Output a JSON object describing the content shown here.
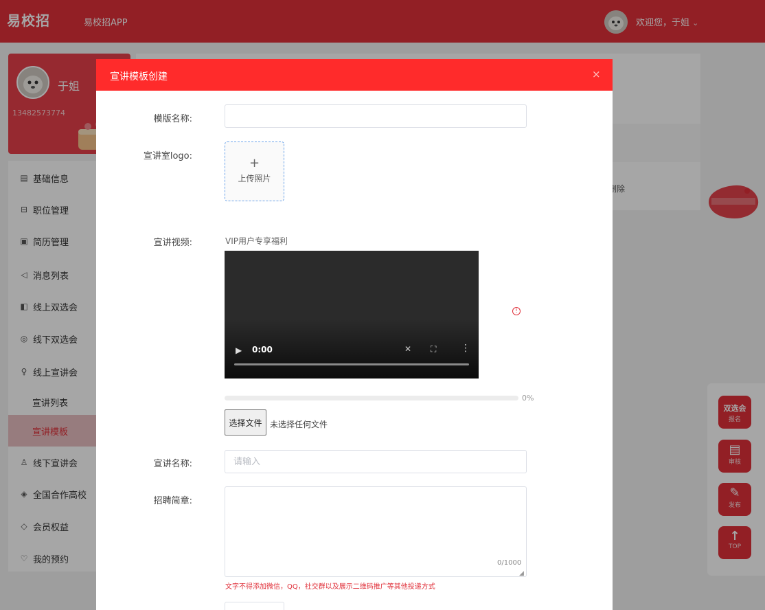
{
  "header": {
    "logo": "易校招",
    "app_link": "易校招APP",
    "welcome": "欢迎您，于姐",
    "chevron": "⌄"
  },
  "profile": {
    "name": "于姐",
    "phone": "13482573774"
  },
  "menu": {
    "items": [
      {
        "label": "基础信息",
        "icon": "document-icon",
        "glyph": "▤"
      },
      {
        "label": "职位管理",
        "icon": "briefcase-icon",
        "glyph": "⊟"
      },
      {
        "label": "简历管理",
        "icon": "resume-icon",
        "glyph": "▣"
      },
      {
        "label": "消息列表",
        "icon": "speaker-icon",
        "glyph": "◁"
      },
      {
        "label": "线上双选会",
        "icon": "screen-icon",
        "glyph": "◧"
      },
      {
        "label": "线下双选会",
        "icon": "location-icon",
        "glyph": "◎"
      },
      {
        "label": "线上宣讲会",
        "icon": "microphone-icon",
        "glyph": "♀"
      }
    ],
    "sub_items": [
      {
        "label": "宣讲列表"
      },
      {
        "label": "宣讲模板"
      }
    ],
    "items_after": [
      {
        "label": "线下宣讲会",
        "icon": "users-icon",
        "glyph": "♙"
      },
      {
        "label": "全国合作高校",
        "icon": "graduation-cap-icon",
        "glyph": "◈"
      },
      {
        "label": "会员权益",
        "icon": "diamond-icon",
        "glyph": "◇"
      },
      {
        "label": "我的预约",
        "icon": "heart-icon",
        "glyph": "♡"
      }
    ]
  },
  "background_rows": {
    "row1_text": "",
    "row2_text": "删除"
  },
  "float_tools": [
    {
      "top": "双选会",
      "bottom": "报名",
      "icon": "dual-selection-icon"
    },
    {
      "glyph": "▤",
      "bottom": "审核",
      "icon": "review-icon"
    },
    {
      "glyph": "✎",
      "bottom": "发布",
      "icon": "publish-icon"
    },
    {
      "glyph": "↑",
      "bottom": "TOP",
      "icon": "arrow-up-icon"
    }
  ],
  "dialog": {
    "title": "宣讲模板创建",
    "close": "×",
    "fields": {
      "template_name_label": "模版名称:",
      "template_name_value": "",
      "logo_label": "宣讲室logo:",
      "upload_plus": "+",
      "upload_text": "上传照片",
      "video_label": "宣讲视频:",
      "vip_note": "VIP用户专享福利",
      "video_time": "0:00",
      "progress_percent": 0,
      "progress_text": "0%",
      "file_button": "选择文件",
      "file_none": "未选择任何文件",
      "lecture_name_label": "宣讲名称:",
      "lecture_name_placeholder": "请输入",
      "brochure_label": "招聘简章:",
      "char_count": "0/1000",
      "warning": "文字不得添加微信，QQ，社交群以及展示二维码推广等其他投递方式"
    }
  },
  "colors": {
    "brand": "#e0303a",
    "dialog_header": "#ff2b2b"
  }
}
